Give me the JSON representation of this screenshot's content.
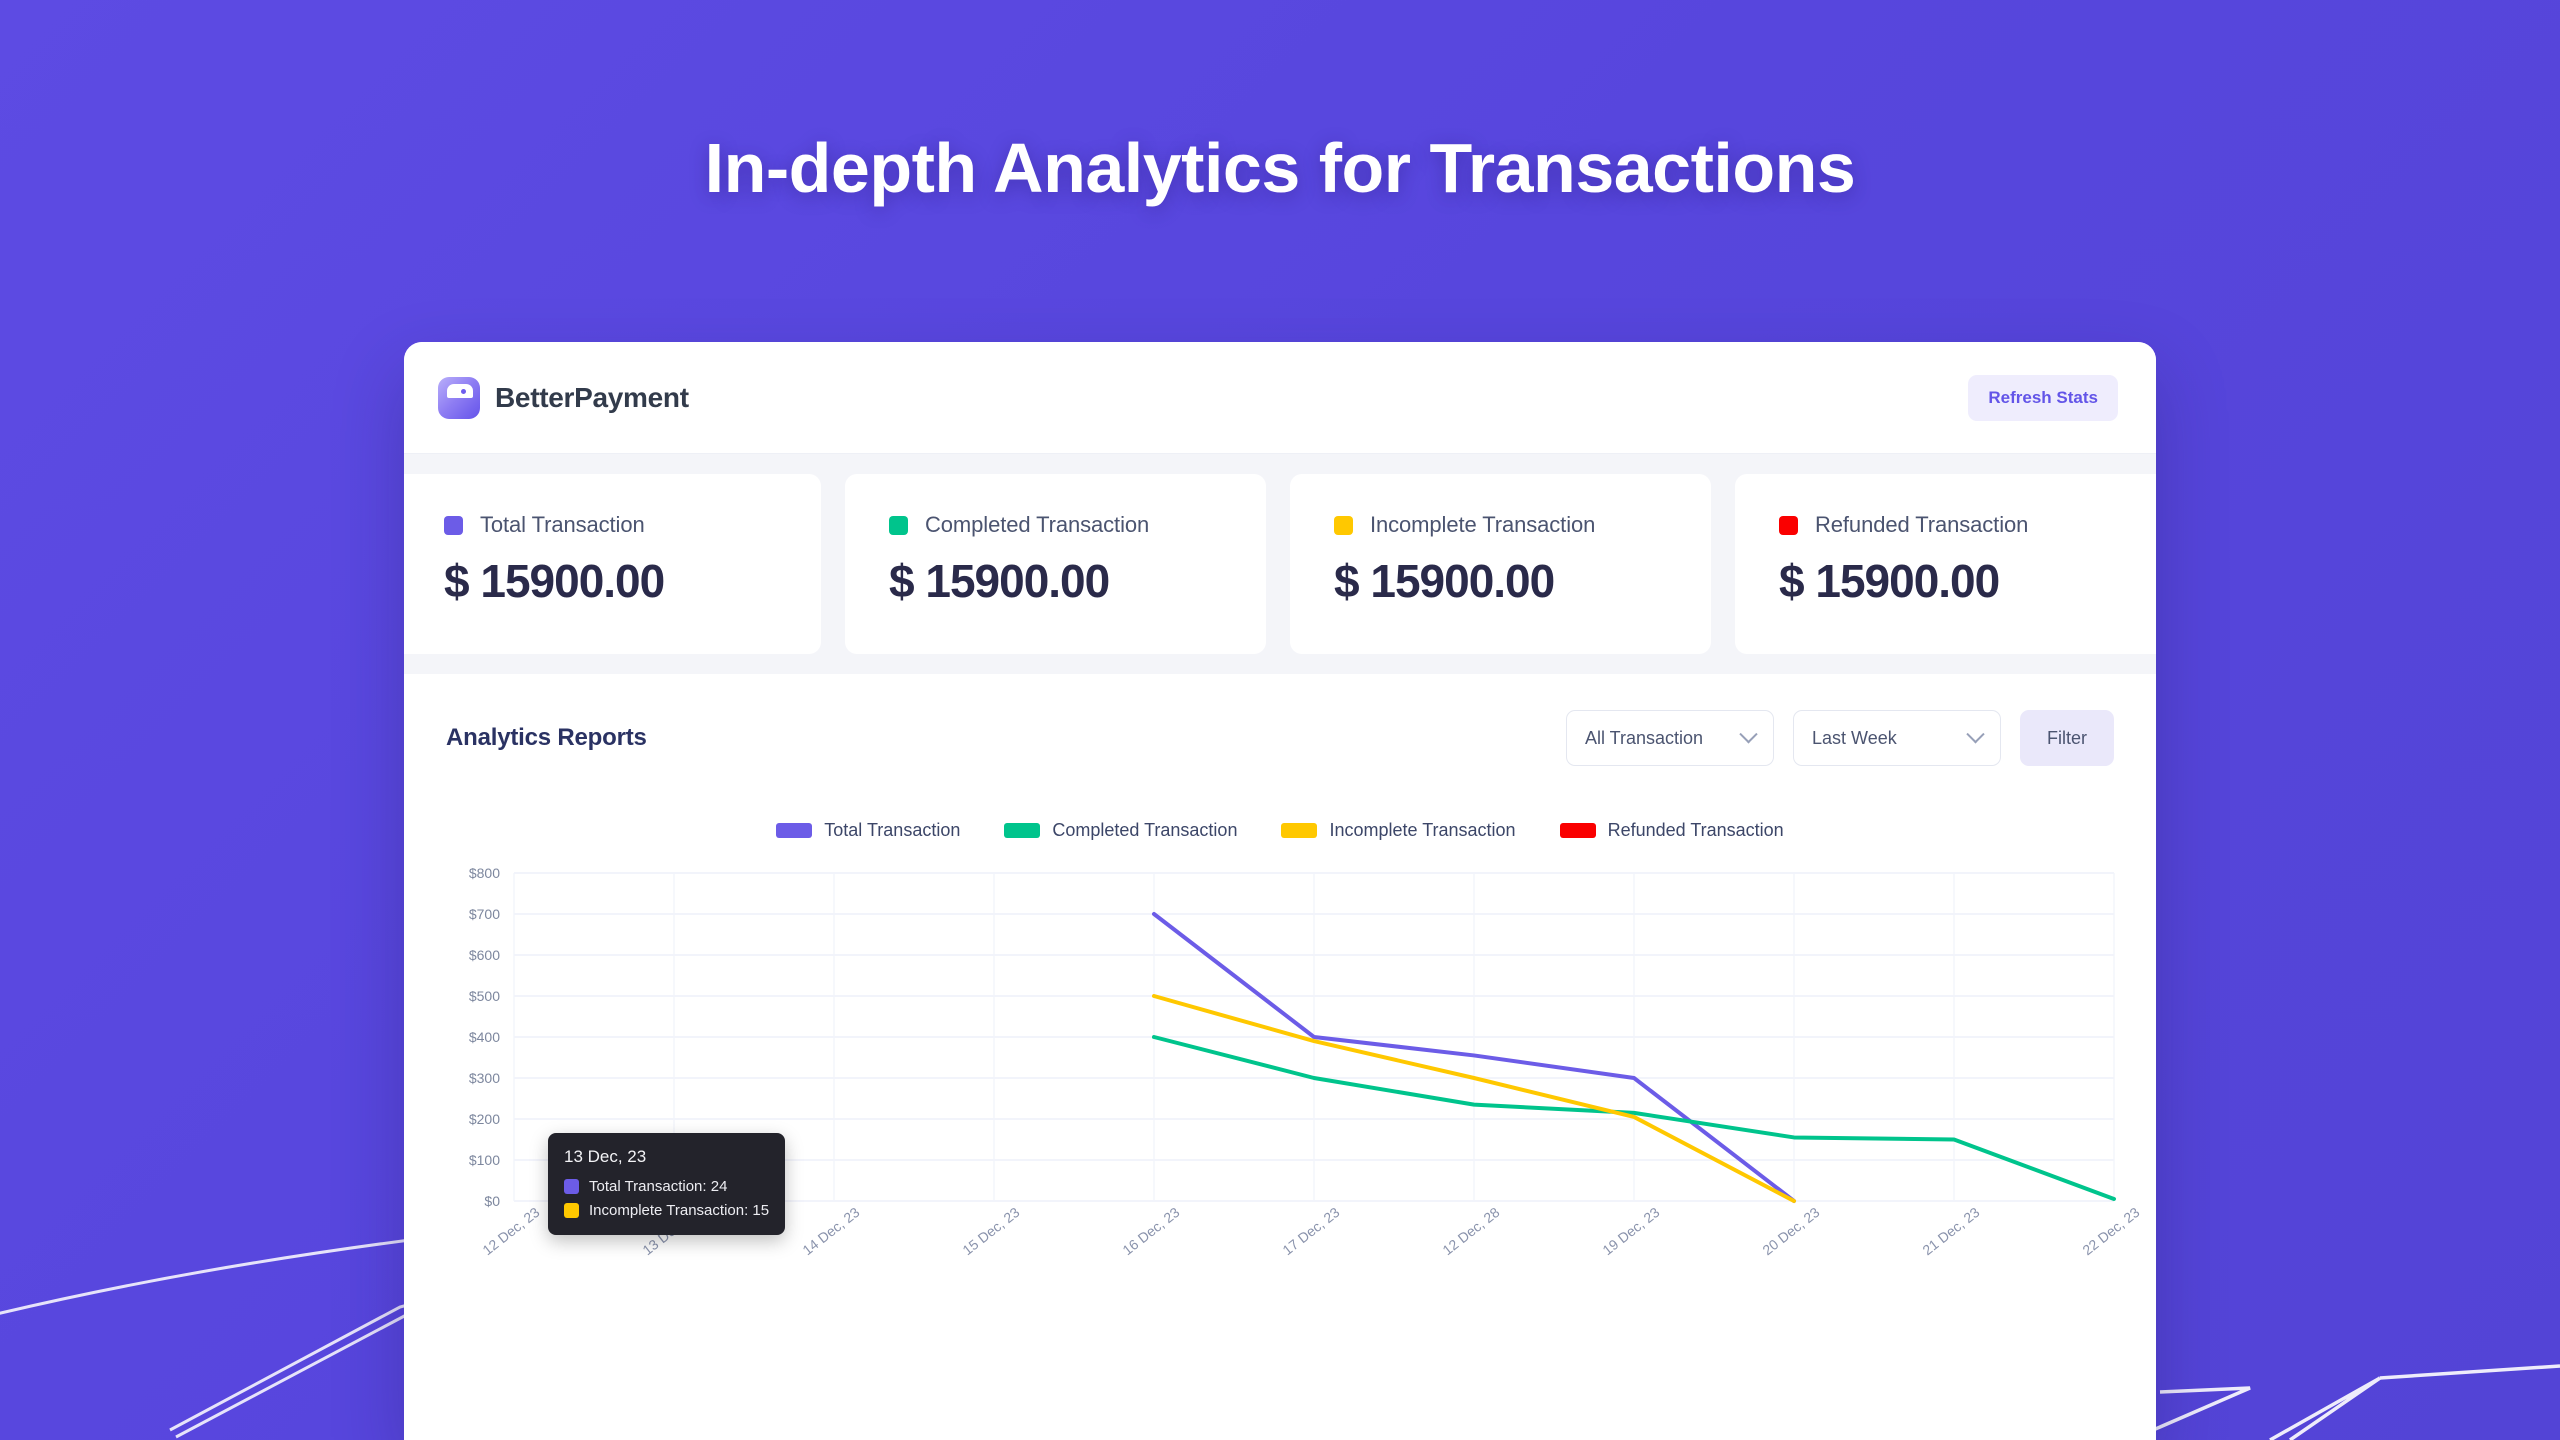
{
  "hero": {
    "title": "In-depth Analytics for Transactions"
  },
  "theme": {
    "background": "#5746DD",
    "brand_purple": "#6355E8",
    "total": "#6C5CE7",
    "completed": "#00C48C",
    "incomplete": "#FFC800",
    "refunded": "#FA0000"
  },
  "topbar": {
    "brand_name": "BetterPayment",
    "logo_icon": "wallet-icon",
    "refresh_label": "Refresh Stats"
  },
  "stats": [
    {
      "label": "Total Transaction",
      "value": "$ 15900.00",
      "color": "#6C5CE7"
    },
    {
      "label": "Completed Transaction",
      "value": "$ 15900.00",
      "color": "#00C48C"
    },
    {
      "label": "Incomplete Transaction",
      "value": "$ 15900.00",
      "color": "#FFC800"
    },
    {
      "label": "Refunded Transaction",
      "value": "$ 15900.00",
      "color": "#FA0000"
    }
  ],
  "reports": {
    "title": "Analytics Reports",
    "transaction_filter": {
      "value": "All Transaction",
      "icon": "chevron-down-icon"
    },
    "period_filter": {
      "value": "Last Week",
      "icon": "chevron-down-icon"
    },
    "filter_label": "Filter"
  },
  "tooltip": {
    "date": "13 Dec, 23",
    "rows": [
      {
        "label": "Total Transaction: 24",
        "color": "#6C5CE7"
      },
      {
        "label": "Incomplete Transaction: 15",
        "color": "#FFC800"
      }
    ]
  },
  "chart_data": {
    "type": "line",
    "title": "Analytics Reports",
    "xlabel": "",
    "ylabel": "",
    "ylim": [
      0,
      800
    ],
    "grid": true,
    "legend_position": "top-center",
    "y_ticks": [
      "$0",
      "$100",
      "$200",
      "$300",
      "$400",
      "$500",
      "$600",
      "$700",
      "$800"
    ],
    "y_tick_values": [
      0,
      100,
      200,
      300,
      400,
      500,
      600,
      700,
      800
    ],
    "categories": [
      "12 Dec, 23",
      "13 Dec, 23",
      "14 Dec, 23",
      "15 Dec, 23",
      "16 Dec, 23",
      "17 Dec, 23",
      "12 Dec, 28",
      "19 Dec, 23",
      "20 Dec, 23",
      "21 Dec, 23",
      "22 Dec, 23"
    ],
    "series": [
      {
        "name": "Total Transaction",
        "color": "#6C5CE7",
        "values": [
          null,
          24,
          null,
          null,
          700,
          400,
          355,
          300,
          0,
          null,
          null
        ]
      },
      {
        "name": "Completed Transaction",
        "color": "#00C48C",
        "values": [
          null,
          null,
          null,
          null,
          400,
          300,
          235,
          215,
          155,
          150,
          5
        ]
      },
      {
        "name": "Incomplete Transaction",
        "color": "#FFC800",
        "values": [
          null,
          15,
          null,
          null,
          500,
          390,
          300,
          205,
          0,
          null,
          null
        ]
      },
      {
        "name": "Refunded Transaction",
        "color": "#FA0000",
        "values": [
          null,
          null,
          null,
          null,
          null,
          null,
          null,
          null,
          null,
          null,
          null
        ]
      }
    ]
  }
}
